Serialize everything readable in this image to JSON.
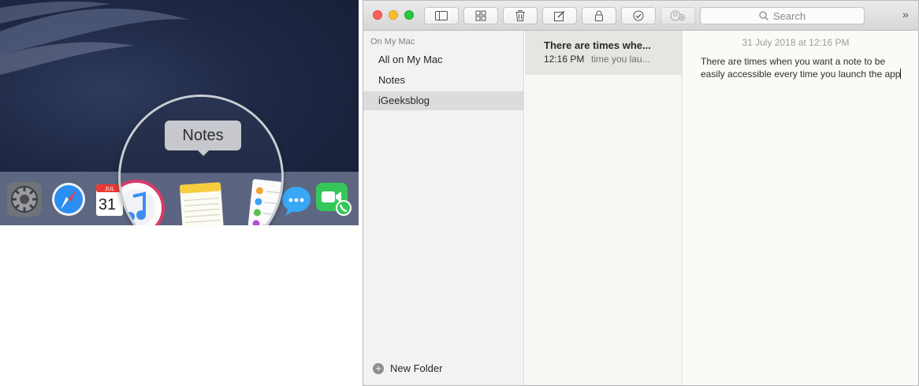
{
  "dock": {
    "tooltip": "Notes",
    "calendar_month": "JUL",
    "calendar_day": "31"
  },
  "window": {
    "search_placeholder": "Search",
    "sidebar": {
      "header": "On My Mac",
      "items": [
        {
          "label": "All on My Mac",
          "selected": false
        },
        {
          "label": "Notes",
          "selected": false
        },
        {
          "label": "iGeeksblog",
          "selected": true
        }
      ],
      "new_folder": "New Folder"
    },
    "note_list": [
      {
        "title": "There are times whe...",
        "time": "12:16 PM",
        "preview": "time you lau..."
      }
    ],
    "editor": {
      "date": "31 July 2018 at 12:16 PM",
      "body": "There are times when you want a note to be easily accessible every time you launch the app"
    }
  },
  "colors": {
    "close": "#fc5f57",
    "minimize": "#fdbc2e",
    "zoom": "#28c840",
    "selected_folder": "#dcdcdf"
  }
}
